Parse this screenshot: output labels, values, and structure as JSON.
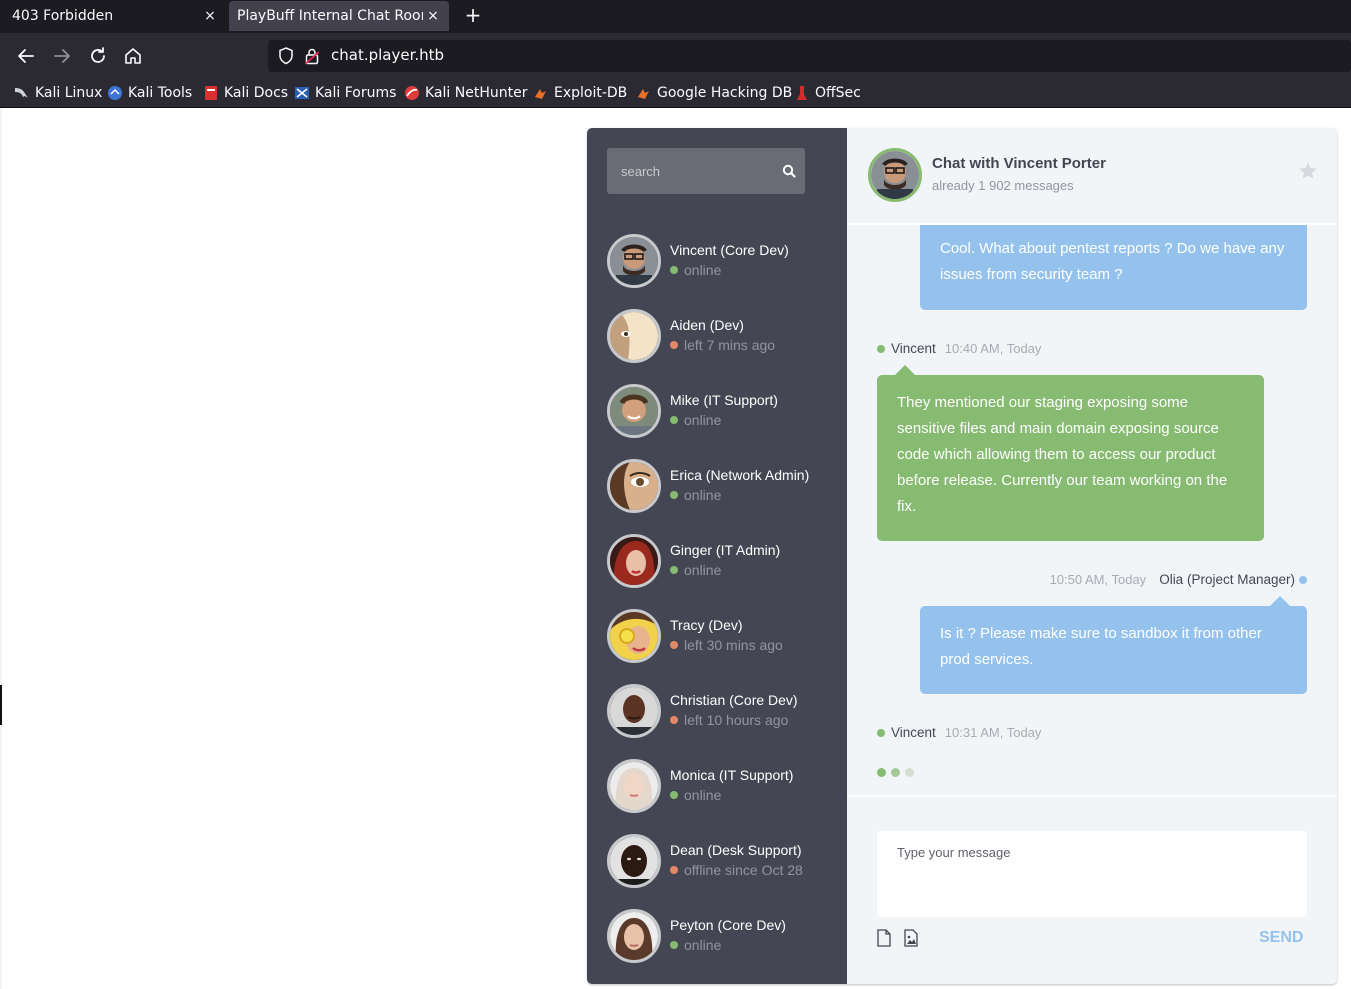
{
  "browser": {
    "tabs": [
      {
        "title": "403 Forbidden",
        "close": "×"
      },
      {
        "title": "PlayBuff Internal Chat Room",
        "close": "×"
      }
    ],
    "new_tab": "+",
    "url": "chat.player.htb",
    "bookmarks": [
      "Kali Linux",
      "Kali Tools",
      "Kali Docs",
      "Kali Forums",
      "Kali NetHunter",
      "Exploit-DB",
      "Google Hacking DB",
      "OffSec"
    ]
  },
  "sidebar": {
    "search_placeholder": "search",
    "people": [
      {
        "name": "Vincent (Core Dev)",
        "status": "online",
        "state": "on"
      },
      {
        "name": "Aiden (Dev)",
        "status": "left 7 mins ago",
        "state": "off"
      },
      {
        "name": "Mike (IT Support)",
        "status": "online",
        "state": "on"
      },
      {
        "name": "Erica (Network Admin)",
        "status": "online",
        "state": "on"
      },
      {
        "name": "Ginger (IT Admin)",
        "status": "online",
        "state": "on"
      },
      {
        "name": "Tracy (Dev)",
        "status": "left 30 mins ago",
        "state": "off"
      },
      {
        "name": "Christian (Core Dev)",
        "status": "left 10 hours ago",
        "state": "off"
      },
      {
        "name": "Monica (IT Support)",
        "status": "online",
        "state": "on"
      },
      {
        "name": "Dean (Desk Support)",
        "status": "offline since Oct 28",
        "state": "off"
      },
      {
        "name": "Peyton (Core Dev)",
        "status": "online",
        "state": "on"
      }
    ]
  },
  "chat": {
    "title": "Chat with Vincent Porter",
    "subtitle": "already 1 902 messages",
    "messages": [
      {
        "text": "Cool. What about pentest reports ? Do we have any issues from security team ?"
      },
      {
        "sender": "Vincent",
        "time": "10:40 AM, Today",
        "text": "They mentioned our staging exposing some sensitive files and main domain exposing source code which allowing them to access our product before release. Currently our team working on the fix."
      },
      {
        "sender": "Olia (Project Manager)",
        "time": "10:50 AM, Today",
        "text": "Is it ? Please make sure to sandbox it from other prod services."
      },
      {
        "sender": "Vincent",
        "time": "10:31 AM, Today"
      }
    ],
    "input_placeholder": "Type your message",
    "send_label": "SEND"
  },
  "colors": {
    "online": "#86bb71",
    "offline": "#e38968",
    "other_bubble": "#94c2ed",
    "mine_bubble": "#86bb71",
    "sidebar_bg": "#444753"
  }
}
